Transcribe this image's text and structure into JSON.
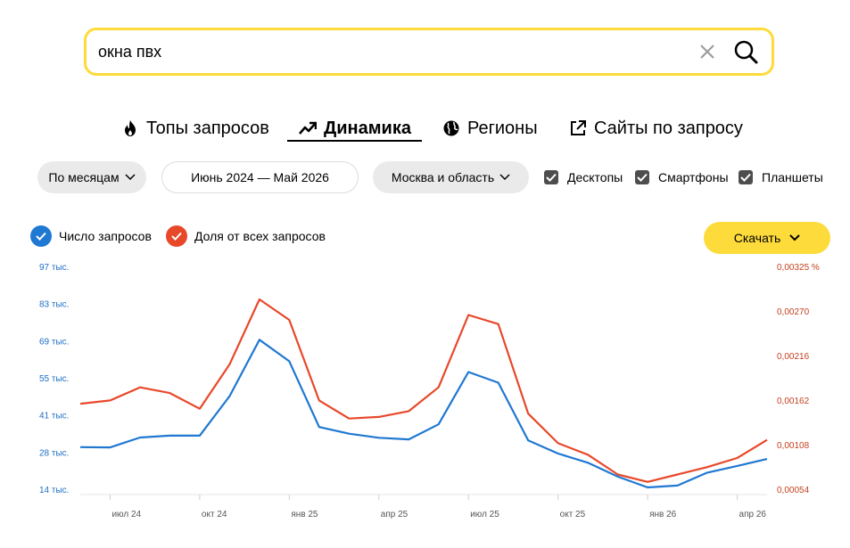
{
  "search": {
    "value": "окна пвх"
  },
  "tabs": [
    {
      "label": "Топы запросов",
      "icon": "fire-icon"
    },
    {
      "label": "Динамика",
      "icon": "trend-up-icon",
      "active": true
    },
    {
      "label": "Регионы",
      "icon": "globe-icon"
    },
    {
      "label": "Сайты по запросу",
      "icon": "external-link-icon"
    }
  ],
  "filters": {
    "period_grouping": "По месяцам",
    "date_range": "Июнь 2024 — Май 2026",
    "region": "Москва и область",
    "devices": [
      {
        "label": "Десктопы",
        "checked": true
      },
      {
        "label": "Смартфоны",
        "checked": true
      },
      {
        "label": "Планшеты",
        "checked": true
      }
    ]
  },
  "legend": {
    "requests": "Число запросов",
    "share": "Доля от всех запросов"
  },
  "download_label": "Скачать",
  "colors": {
    "accent": "#fddb3a",
    "requests_series": "#1f78d1",
    "share_series": "#e8482a"
  },
  "chart_data": {
    "type": "line",
    "x": [
      "июн 24",
      "июл 24",
      "авг 24",
      "сен 24",
      "окт 24",
      "ноя 24",
      "дек 24",
      "янв 25",
      "фев 25",
      "мар 25",
      "апр 25",
      "май 25",
      "июн 25",
      "июл 25",
      "авг 25",
      "сен 25",
      "окт 25",
      "ноя 25",
      "дек 25",
      "янв 26",
      "фев 26",
      "мар 26",
      "апр 26",
      "май 26"
    ],
    "x_tick_labels": [
      "июл 24",
      "окт 24",
      "янв 25",
      "апр 25",
      "июл 25",
      "окт 25",
      "янв 26",
      "апр 26"
    ],
    "left_axis": {
      "ticks": [
        "97 тыс.",
        "83 тыс.",
        "69 тыс.",
        "55 тыс.",
        "41 тыс.",
        "28 тыс.",
        "14 тыс."
      ],
      "range": [
        14000,
        97000
      ]
    },
    "right_axis": {
      "ticks": [
        "0,00325 %",
        "0,00270",
        "0,00216",
        "0,00162",
        "0,00108",
        "0,00054"
      ],
      "range": [
        0.00054,
        0.00325
      ]
    },
    "series": [
      {
        "name": "Число запросов",
        "axis": "left",
        "values": [
          30000,
          29900,
          33600,
          34300,
          34300,
          49000,
          70000,
          62000,
          37500,
          35000,
          33500,
          32900,
          38500,
          58000,
          54000,
          32500,
          27600,
          24200,
          19000,
          15000,
          15700,
          20500,
          23000,
          25600
        ]
      },
      {
        "name": "Доля от всех запросов",
        "axis": "right",
        "values": [
          0.00159,
          0.00163,
          0.00179,
          0.00172,
          0.00153,
          0.00207,
          0.00286,
          0.00261,
          0.00163,
          0.00141,
          0.00143,
          0.0015,
          0.00179,
          0.00267,
          0.00256,
          0.00147,
          0.00111,
          0.00097,
          0.00073,
          0.00064,
          0.00073,
          0.00082,
          0.00093,
          0.00115
        ]
      }
    ],
    "grid": false,
    "legend_position": "top-left"
  }
}
